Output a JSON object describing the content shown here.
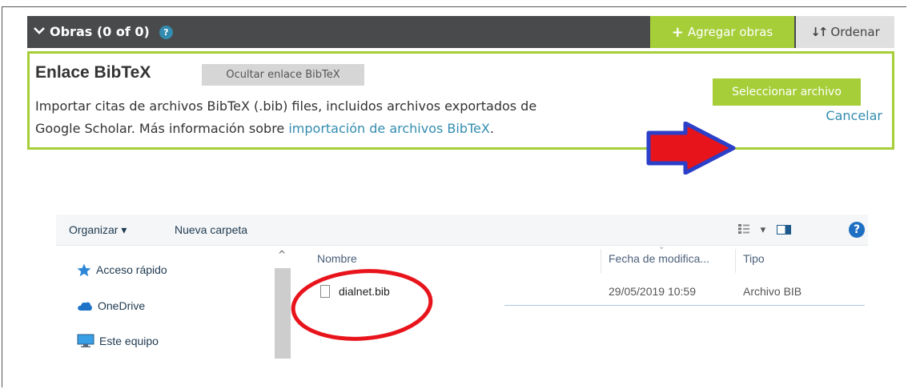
{
  "works": {
    "title": "Obras (0 of 0)",
    "help_glyph": "?",
    "add_label": "Agregar obras",
    "sort_label": "Ordenar"
  },
  "bibtex": {
    "title": "Enlace BibTeX",
    "hide_label": "Ocultar enlace BibTeX",
    "desc_line1": "Importar citas de archivos BibTeX (.bib) files, incluidos archivos exportados de",
    "desc_line2_prefix": "Google Scholar. Más información sobre ",
    "desc_link": "importación de archivos BibTeX",
    "desc_suffix": ".",
    "cancel_label": "Cancelar",
    "select_label": "Seleccionar archivo"
  },
  "dialog": {
    "toolbar": {
      "organize_label": "Organizar ▾",
      "new_folder_label": "Nueva carpeta",
      "view_glyph": "▾",
      "help_glyph": "?"
    },
    "nav": [
      {
        "label": "Acceso rápido",
        "icon": "star-icon"
      },
      {
        "label": "OneDrive",
        "icon": "cloud-icon"
      },
      {
        "label": "Este equipo",
        "icon": "computer-icon"
      }
    ],
    "columns": {
      "name": "Nombre",
      "date": "Fecha de modifica...",
      "type": "Tipo"
    },
    "files": [
      {
        "name": "dialnet.bib",
        "date": "29/05/2019 10:59",
        "type": "Archivo BIB"
      }
    ]
  },
  "colors": {
    "orcid_green": "#a6ce39",
    "header_dark": "#494a4c",
    "link_blue": "#338caf",
    "annotation_red": "#e8141c",
    "annotation_blue": "#2b3fc8"
  }
}
